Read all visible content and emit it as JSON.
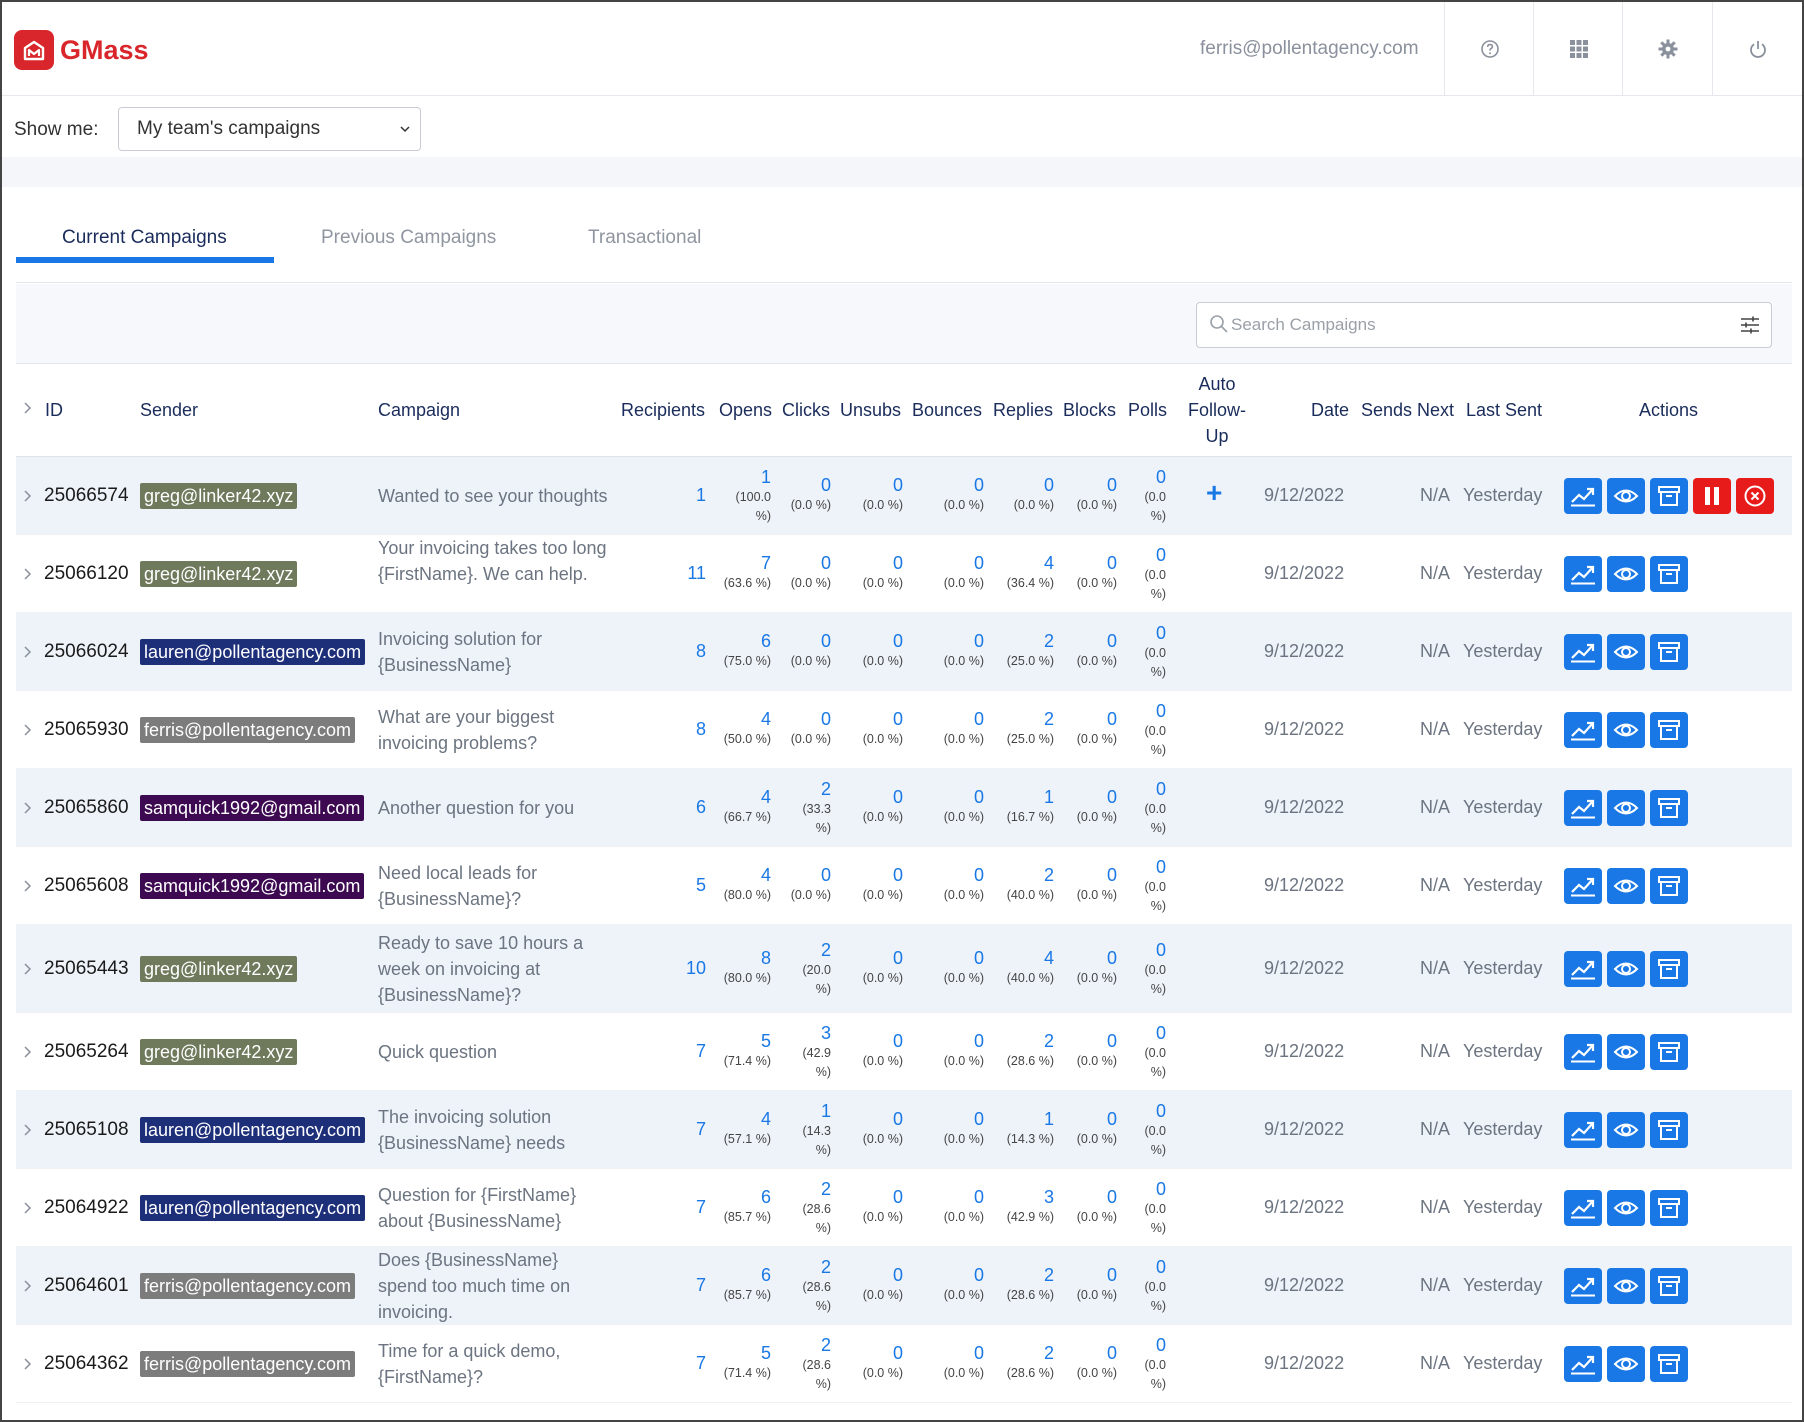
{
  "app": {
    "name": "GMass",
    "user_email": "ferris@pollentagency.com"
  },
  "colors": {
    "accent": "#1978e5",
    "brand": "#d9262c",
    "danger": "#e81b1b"
  },
  "top_icons": [
    "help-icon",
    "apps-grid-icon",
    "gear-icon",
    "power-icon"
  ],
  "filter": {
    "label": "Show me:",
    "selected": "My team's campaigns"
  },
  "tabs": [
    {
      "label": "Current Campaigns",
      "active": true
    },
    {
      "label": "Previous Campaigns",
      "active": false
    },
    {
      "label": "Transactional",
      "active": false
    }
  ],
  "search": {
    "placeholder": "Search Campaigns"
  },
  "columns": {
    "id": "ID",
    "sender": "Sender",
    "campaign": "Campaign",
    "recipients": "Recipients",
    "opens": "Opens",
    "clicks": "Clicks",
    "unsubs": "Unsubs",
    "bounces": "Bounces",
    "replies": "Replies",
    "blocks": "Blocks",
    "polls": "Polls",
    "auto1": "Auto",
    "auto2": "Follow-",
    "auto3": "Up",
    "date": "Date",
    "sends_next": "Sends Next",
    "last_sent": "Last Sent",
    "actions": "Actions"
  },
  "sender_colors": {
    "greg@linker42.xyz": "#6f7a5d",
    "lauren@pollentagency.com": "#1e2f7a",
    "ferris@pollentagency.com": "#7c7c7c",
    "samquick1992@gmail.com": "#3d0a52"
  },
  "rows": [
    {
      "id": "25066574",
      "sender": "greg@linker42.xyz",
      "campaign": "Wanted to see your thoughts",
      "recipients": "1",
      "opens": {
        "n": "1",
        "p1": "(100.0",
        "p2": "%)"
      },
      "clicks": {
        "n": "0",
        "p1": "(0.0 %)",
        "p2": ""
      },
      "unsubs": {
        "n": "0",
        "p1": "(0.0 %)"
      },
      "bounces": {
        "n": "0",
        "p1": "(0.0 %)"
      },
      "replies": {
        "n": "0",
        "p1": "(0.0 %)"
      },
      "blocks": {
        "n": "0",
        "p1": "(0.0 %)"
      },
      "polls": {
        "n": "0",
        "p1": "(0.0",
        "p2": "%)"
      },
      "auto_followup": "+",
      "date": "9/12/2022",
      "sends_next": "N/A",
      "last_sent": "Yesterday",
      "extra_actions": true
    },
    {
      "id": "25066120",
      "sender": "greg@linker42.xyz",
      "campaign": "Your invoicing takes too long {FirstName}. We can help.",
      "recipients": "11",
      "opens": {
        "n": "7",
        "p1": "(63.6 %)",
        "p2": ""
      },
      "clicks": {
        "n": "0",
        "p1": "(0.0 %)",
        "p2": ""
      },
      "unsubs": {
        "n": "0",
        "p1": "(0.0 %)"
      },
      "bounces": {
        "n": "0",
        "p1": "(0.0 %)"
      },
      "replies": {
        "n": "4",
        "p1": "(36.4 %)"
      },
      "blocks": {
        "n": "0",
        "p1": "(0.0 %)"
      },
      "polls": {
        "n": "0",
        "p1": "(0.0",
        "p2": "%)"
      },
      "auto_followup": "",
      "date": "9/12/2022",
      "sends_next": "N/A",
      "last_sent": "Yesterday",
      "extra_actions": false
    },
    {
      "id": "25066024",
      "sender": "lauren@pollentagency.com",
      "campaign": "Invoicing solution for {BusinessName}",
      "recipients": "8",
      "opens": {
        "n": "6",
        "p1": "(75.0 %)",
        "p2": ""
      },
      "clicks": {
        "n": "0",
        "p1": "(0.0 %)",
        "p2": ""
      },
      "unsubs": {
        "n": "0",
        "p1": "(0.0 %)"
      },
      "bounces": {
        "n": "0",
        "p1": "(0.0 %)"
      },
      "replies": {
        "n": "2",
        "p1": "(25.0 %)"
      },
      "blocks": {
        "n": "0",
        "p1": "(0.0 %)"
      },
      "polls": {
        "n": "0",
        "p1": "(0.0",
        "p2": "%)"
      },
      "auto_followup": "",
      "date": "9/12/2022",
      "sends_next": "N/A",
      "last_sent": "Yesterday",
      "extra_actions": false
    },
    {
      "id": "25065930",
      "sender": "ferris@pollentagency.com",
      "campaign": "What are your biggest invoicing problems?",
      "recipients": "8",
      "opens": {
        "n": "4",
        "p1": "(50.0 %)",
        "p2": ""
      },
      "clicks": {
        "n": "0",
        "p1": "(0.0 %)",
        "p2": ""
      },
      "unsubs": {
        "n": "0",
        "p1": "(0.0 %)"
      },
      "bounces": {
        "n": "0",
        "p1": "(0.0 %)"
      },
      "replies": {
        "n": "2",
        "p1": "(25.0 %)"
      },
      "blocks": {
        "n": "0",
        "p1": "(0.0 %)"
      },
      "polls": {
        "n": "0",
        "p1": "(0.0",
        "p2": "%)"
      },
      "auto_followup": "",
      "date": "9/12/2022",
      "sends_next": "N/A",
      "last_sent": "Yesterday",
      "extra_actions": false
    },
    {
      "id": "25065860",
      "sender": "samquick1992@gmail.com",
      "campaign": "Another question for you",
      "recipients": "6",
      "opens": {
        "n": "4",
        "p1": "(66.7 %)",
        "p2": ""
      },
      "clicks": {
        "n": "2",
        "p1": "(33.3",
        "p2": "%)"
      },
      "unsubs": {
        "n": "0",
        "p1": "(0.0 %)"
      },
      "bounces": {
        "n": "0",
        "p1": "(0.0 %)"
      },
      "replies": {
        "n": "1",
        "p1": "(16.7 %)"
      },
      "blocks": {
        "n": "0",
        "p1": "(0.0 %)"
      },
      "polls": {
        "n": "0",
        "p1": "(0.0",
        "p2": "%)"
      },
      "auto_followup": "",
      "date": "9/12/2022",
      "sends_next": "N/A",
      "last_sent": "Yesterday",
      "extra_actions": false
    },
    {
      "id": "25065608",
      "sender": "samquick1992@gmail.com",
      "campaign": "Need local leads for {BusinessName}?",
      "recipients": "5",
      "opens": {
        "n": "4",
        "p1": "(80.0 %)",
        "p2": ""
      },
      "clicks": {
        "n": "0",
        "p1": "(0.0 %)",
        "p2": ""
      },
      "unsubs": {
        "n": "0",
        "p1": "(0.0 %)"
      },
      "bounces": {
        "n": "0",
        "p1": "(0.0 %)"
      },
      "replies": {
        "n": "2",
        "p1": "(40.0 %)"
      },
      "blocks": {
        "n": "0",
        "p1": "(0.0 %)"
      },
      "polls": {
        "n": "0",
        "p1": "(0.0",
        "p2": "%)"
      },
      "auto_followup": "",
      "date": "9/12/2022",
      "sends_next": "N/A",
      "last_sent": "Yesterday",
      "extra_actions": false
    },
    {
      "id": "25065443",
      "sender": "greg@linker42.xyz",
      "campaign": "Ready to save 10 hours a week on invoicing at {BusinessName}?",
      "recipients": "10",
      "opens": {
        "n": "8",
        "p1": "(80.0 %)",
        "p2": ""
      },
      "clicks": {
        "n": "2",
        "p1": "(20.0",
        "p2": "%)"
      },
      "unsubs": {
        "n": "0",
        "p1": "(0.0 %)"
      },
      "bounces": {
        "n": "0",
        "p1": "(0.0 %)"
      },
      "replies": {
        "n": "4",
        "p1": "(40.0 %)"
      },
      "blocks": {
        "n": "0",
        "p1": "(0.0 %)"
      },
      "polls": {
        "n": "0",
        "p1": "(0.0",
        "p2": "%)"
      },
      "auto_followup": "",
      "date": "9/12/2022",
      "sends_next": "N/A",
      "last_sent": "Yesterday",
      "extra_actions": false
    },
    {
      "id": "25065264",
      "sender": "greg@linker42.xyz",
      "campaign": "Quick question",
      "recipients": "7",
      "opens": {
        "n": "5",
        "p1": "(71.4 %)",
        "p2": ""
      },
      "clicks": {
        "n": "3",
        "p1": "(42.9",
        "p2": "%)"
      },
      "unsubs": {
        "n": "0",
        "p1": "(0.0 %)"
      },
      "bounces": {
        "n": "0",
        "p1": "(0.0 %)"
      },
      "replies": {
        "n": "2",
        "p1": "(28.6 %)"
      },
      "blocks": {
        "n": "0",
        "p1": "(0.0 %)"
      },
      "polls": {
        "n": "0",
        "p1": "(0.0",
        "p2": "%)"
      },
      "auto_followup": "",
      "date": "9/12/2022",
      "sends_next": "N/A",
      "last_sent": "Yesterday",
      "extra_actions": false
    },
    {
      "id": "25065108",
      "sender": "lauren@pollentagency.com",
      "campaign": "The invoicing solution {BusinessName} needs",
      "recipients": "7",
      "opens": {
        "n": "4",
        "p1": "(57.1 %)",
        "p2": ""
      },
      "clicks": {
        "n": "1",
        "p1": "(14.3",
        "p2": "%)"
      },
      "unsubs": {
        "n": "0",
        "p1": "(0.0 %)"
      },
      "bounces": {
        "n": "0",
        "p1": "(0.0 %)"
      },
      "replies": {
        "n": "1",
        "p1": "(14.3 %)"
      },
      "blocks": {
        "n": "0",
        "p1": "(0.0 %)"
      },
      "polls": {
        "n": "0",
        "p1": "(0.0",
        "p2": "%)"
      },
      "auto_followup": "",
      "date": "9/12/2022",
      "sends_next": "N/A",
      "last_sent": "Yesterday",
      "extra_actions": false
    },
    {
      "id": "25064922",
      "sender": "lauren@pollentagency.com",
      "campaign": "Question for {FirstName} about {BusinessName}",
      "recipients": "7",
      "opens": {
        "n": "6",
        "p1": "(85.7 %)",
        "p2": ""
      },
      "clicks": {
        "n": "2",
        "p1": "(28.6",
        "p2": "%)"
      },
      "unsubs": {
        "n": "0",
        "p1": "(0.0 %)"
      },
      "bounces": {
        "n": "0",
        "p1": "(0.0 %)"
      },
      "replies": {
        "n": "3",
        "p1": "(42.9 %)"
      },
      "blocks": {
        "n": "0",
        "p1": "(0.0 %)"
      },
      "polls": {
        "n": "0",
        "p1": "(0.0",
        "p2": "%)"
      },
      "auto_followup": "",
      "date": "9/12/2022",
      "sends_next": "N/A",
      "last_sent": "Yesterday",
      "extra_actions": false
    },
    {
      "id": "25064601",
      "sender": "ferris@pollentagency.com",
      "campaign": "Does {BusinessName} spend too much time on invoicing.",
      "recipients": "7",
      "opens": {
        "n": "6",
        "p1": "(85.7 %)",
        "p2": ""
      },
      "clicks": {
        "n": "2",
        "p1": "(28.6",
        "p2": "%)"
      },
      "unsubs": {
        "n": "0",
        "p1": "(0.0 %)"
      },
      "bounces": {
        "n": "0",
        "p1": "(0.0 %)"
      },
      "replies": {
        "n": "2",
        "p1": "(28.6 %)"
      },
      "blocks": {
        "n": "0",
        "p1": "(0.0 %)"
      },
      "polls": {
        "n": "0",
        "p1": "(0.0",
        "p2": "%)"
      },
      "auto_followup": "",
      "date": "9/12/2022",
      "sends_next": "N/A",
      "last_sent": "Yesterday",
      "extra_actions": false
    },
    {
      "id": "25064362",
      "sender": "ferris@pollentagency.com",
      "campaign": "Time for a quick demo, {FirstName}?",
      "recipients": "7",
      "opens": {
        "n": "5",
        "p1": "(71.4 %)",
        "p2": ""
      },
      "clicks": {
        "n": "2",
        "p1": "(28.6",
        "p2": "%)"
      },
      "unsubs": {
        "n": "0",
        "p1": "(0.0 %)"
      },
      "bounces": {
        "n": "0",
        "p1": "(0.0 %)"
      },
      "replies": {
        "n": "2",
        "p1": "(28.6 %)"
      },
      "blocks": {
        "n": "0",
        "p1": "(0.0 %)"
      },
      "polls": {
        "n": "0",
        "p1": "(0.0",
        "p2": "%)"
      },
      "auto_followup": "",
      "date": "9/12/2022",
      "sends_next": "N/A",
      "last_sent": "Yesterday",
      "extra_actions": false
    }
  ]
}
